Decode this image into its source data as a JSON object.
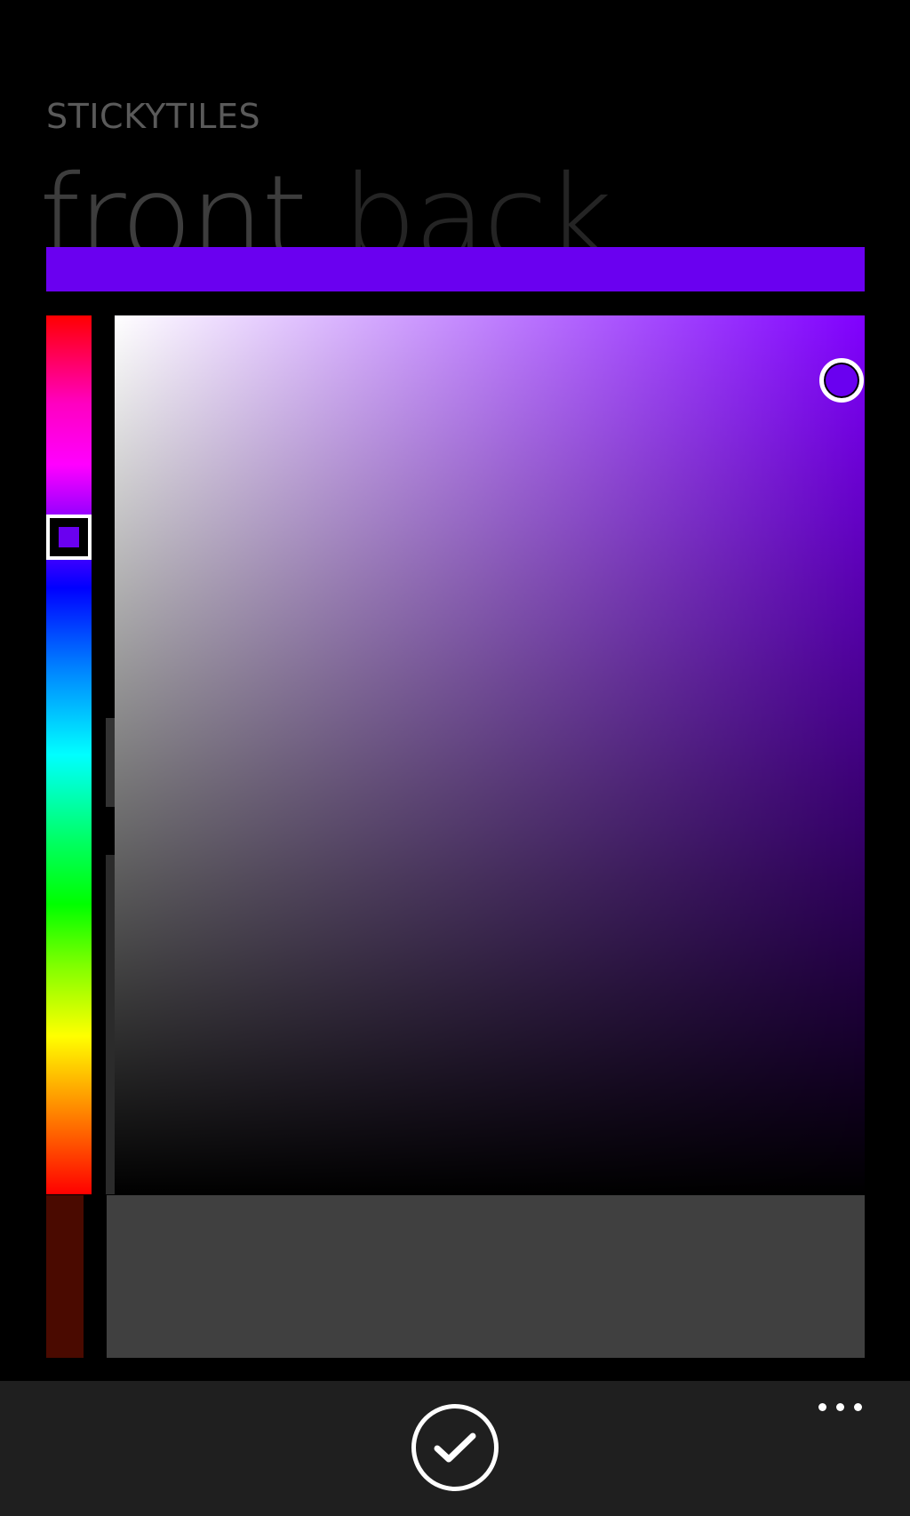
{
  "header": {
    "app_title": "STICKYTILES"
  },
  "pivot": {
    "tabs": [
      {
        "label": "front",
        "selected": true
      },
      {
        "label": "back",
        "selected": false
      }
    ]
  },
  "colors": {
    "selected_color": "#6a00f0",
    "hue_color": "#8000ff",
    "app_bar_background": "#1f1f1f"
  },
  "app_bar": {
    "primary_icon": "check-icon",
    "more_icon": "ellipsis-icon"
  }
}
